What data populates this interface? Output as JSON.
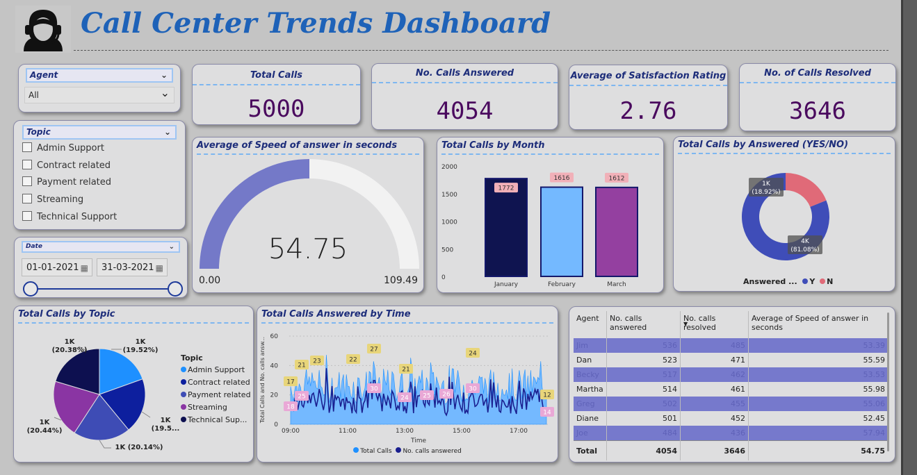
{
  "header": {
    "title": "Call Center Trends Dashboard"
  },
  "kpis": {
    "total_calls": {
      "label": "Total Calls",
      "value": "5000"
    },
    "answered": {
      "label": "No. Calls Answered",
      "value": "4054"
    },
    "satisfaction": {
      "label": "Average of Satisfaction Rating",
      "value": "2.76"
    },
    "resolved": {
      "label": "No. of Calls Resolved",
      "value": "3646"
    }
  },
  "filters": {
    "agent": {
      "label": "Agent",
      "value": "All"
    },
    "topic": {
      "label": "Topic",
      "options": [
        "Admin Support",
        "Contract related",
        "Payment related",
        "Streaming",
        "Technical Support"
      ]
    },
    "date": {
      "label": "Date",
      "start": "01-01-2021",
      "end": "31-03-2021"
    }
  },
  "gauge": {
    "title": "Average of Speed of answer in seconds",
    "value": "54.75",
    "min": "0.00",
    "max": "109.49",
    "fill_fraction": 0.5
  },
  "month_chart": {
    "title": "Total Calls by Month",
    "chart_data": {
      "type": "bar",
      "categories": [
        "January",
        "February",
        "March"
      ],
      "values": [
        1772,
        1616,
        1612
      ],
      "labels": [
        "1772",
        "1616",
        "1612"
      ],
      "yticks": [
        "2000",
        "1500",
        "1000",
        "500",
        "0"
      ],
      "ylim": [
        0,
        2000
      ],
      "colors": [
        "#0f1450",
        "#74b9ff",
        "#9440a0"
      ]
    }
  },
  "answered_chart": {
    "title": "Total Calls by Answered (YES/NO)",
    "legend_title": "Answered ...",
    "chart_data": {
      "type": "pie",
      "donut": true,
      "slices": [
        {
          "name": "Y",
          "value": 81.08,
          "label": "4K",
          "pct": "(81.08%)",
          "color": "#3f4db8"
        },
        {
          "name": "N",
          "value": 18.92,
          "label": "1K",
          "pct": "(18.92%)",
          "color": "#e06a78"
        }
      ]
    }
  },
  "topic_chart": {
    "title": "Total Calls by Topic",
    "legend_title": "Topic",
    "chart_data": {
      "type": "pie",
      "slices": [
        {
          "name": "Admin Support",
          "legend": "Admin Support",
          "value": 19.52,
          "label": "1K",
          "pct": "(19.52%)",
          "color": "#1e90ff"
        },
        {
          "name": "Contract related",
          "legend": "Contract related",
          "value": 19.52,
          "label": "1K",
          "pct": "(19.5...",
          "color": "#0d1f9e"
        },
        {
          "name": "Payment related",
          "legend": "Payment related",
          "value": 20.14,
          "label": "1K (20.14%)",
          "pct": "",
          "color": "#3e4cb5"
        },
        {
          "name": "Streaming",
          "legend": "Streaming",
          "value": 20.44,
          "label": "1K",
          "pct": "(20.44%)",
          "color": "#8a35a3"
        },
        {
          "name": "Technical Support",
          "legend": "Technical Sup...",
          "value": 20.38,
          "label": "1K",
          "pct": "(20.38%)",
          "color": "#0d1050"
        }
      ]
    }
  },
  "time_chart": {
    "title": "Total Calls Answered by Time",
    "xlabel": "Time",
    "ylabel": "Total Calls and No. calls answ...",
    "legend": {
      "total": "Total Calls",
      "answered": "No. calls answered"
    },
    "chart_data": {
      "type": "area",
      "xticks": [
        "09:00",
        "11:00",
        "13:00",
        "15:00",
        "17:00"
      ],
      "yticks": [
        "60",
        "40",
        "20",
        "0"
      ],
      "ylim": [
        0,
        60
      ],
      "answered_labels": [
        "17",
        "21",
        "23",
        "22",
        "27",
        "21",
        "24",
        "12"
      ],
      "total_labels": [
        "18",
        "25",
        "30",
        "24",
        "25",
        "26",
        "30",
        "14"
      ]
    }
  },
  "agent_table": {
    "columns": [
      "Agent",
      "No. calls answered",
      "No. calls resolved",
      "Average of Speed of answer in seconds"
    ],
    "rows": [
      {
        "agent": "Jim",
        "answered": "536",
        "resolved": "485",
        "speed": "53.39"
      },
      {
        "agent": "Dan",
        "answered": "523",
        "resolved": "471",
        "speed": "55.59"
      },
      {
        "agent": "Becky",
        "answered": "517",
        "resolved": "462",
        "speed": "53.53"
      },
      {
        "agent": "Martha",
        "answered": "514",
        "resolved": "461",
        "speed": "55.98"
      },
      {
        "agent": "Greg",
        "answered": "502",
        "resolved": "455",
        "speed": "55.06"
      },
      {
        "agent": "Diane",
        "answered": "501",
        "resolved": "452",
        "speed": "52.45"
      },
      {
        "agent": "Joe",
        "answered": "484",
        "resolved": "436",
        "speed": "57.94"
      }
    ],
    "total": {
      "label": "Total",
      "answered": "4054",
      "resolved": "3646",
      "speed": "54.75"
    }
  }
}
